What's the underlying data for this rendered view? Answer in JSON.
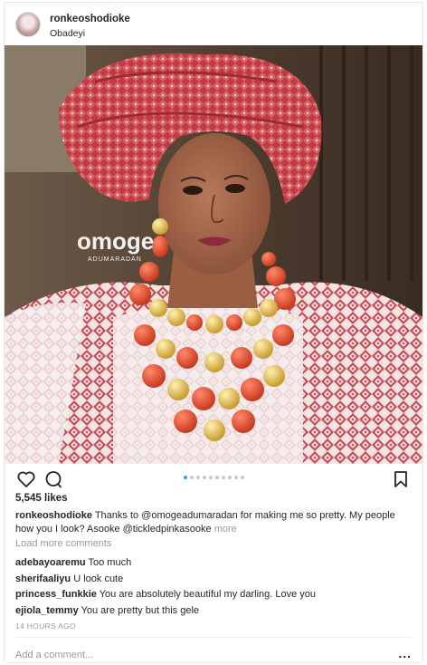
{
  "post": {
    "username": "ronkeoshodioke",
    "location": "Obadeyi",
    "image": {
      "description_icon": "photo-portrait",
      "watermark": "omoge",
      "watermark_sub": "ADUMARADAN"
    },
    "carousel": {
      "count": 10,
      "active_index": 0
    },
    "likes": "5,545 likes",
    "caption": {
      "username": "ronkeoshodioke",
      "text": "Thanks to @omogeadumaradan for making me so pretty. My people how you I look? Asooke @tickledpinkasooke",
      "more": "more"
    },
    "load_more": "Load more comments",
    "comments": [
      {
        "username": "adebayoaremu",
        "text": "Too much"
      },
      {
        "username": "sherifaaliyu",
        "text": "U look cute"
      },
      {
        "username": "princess_funkkie",
        "text": "You are absolutely beautiful my darling. Love you"
      },
      {
        "username": "ejiola_temmy",
        "text": "You are pretty but this gele"
      }
    ],
    "timestamp": "14 HOURS AGO",
    "add_comment_placeholder": "Add a comment...",
    "options_label": "...",
    "colors": {
      "accent": "#3897f0",
      "muted": "#999999",
      "text": "#262626"
    }
  }
}
